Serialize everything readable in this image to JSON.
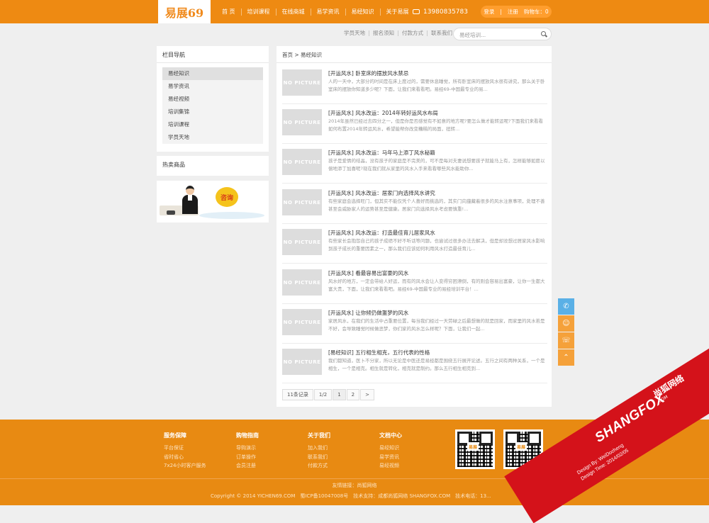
{
  "header": {
    "logo": "易展69",
    "nav": [
      "首 页",
      "培训课程",
      "在线商城",
      "易学资讯",
      "易经知识",
      "关于易展"
    ],
    "phone": "13980835783",
    "user_links": [
      "登录",
      "|",
      "注册",
      "购物车：0"
    ]
  },
  "sublinks": [
    "学员天地",
    "报名须知",
    "付款方式",
    "联系我们"
  ],
  "search": {
    "placeholder": "易经培训..."
  },
  "sidebar": {
    "title": "栏目导航",
    "items": [
      "易经知识",
      "易学资讯",
      "易经视频",
      "培训集锦",
      "培训课程",
      "学员天地"
    ],
    "hot_title": "热卖商品",
    "ad_text": "咨询"
  },
  "main": {
    "breadcrumb": "首页 > 易经知识",
    "placeholder_text": "NO PICTURE",
    "articles": [
      {
        "title": "[开运风水] 卧室床的摆放风水禁忌",
        "desc": "人的一天中，大部分的时间是在床上度过的，需要休息睡觉，所有卧室床的摆放风水很有讲究，那么关于卧室床的摆放你知道多少呢？下面，让我们来看看吧。易经69-中国最专业的易..."
      },
      {
        "title": "[开运风水] 风水改运：2014年转好运风水布局",
        "desc": "2014年虽然已经过去四分之一，但是你是否感觉有不如意的地方呢?要怎么做才能转运呢?下面我们来看看如何布置2014年转运风水，希望能帮你改变糟糕的局面，扭转..."
      },
      {
        "title": "[开运风水] 风水改运：马年马上添丁风水秘籍",
        "desc": "孩子是爱情的结晶，没有孩子的家庭是不完美的，可不是每对夫妻说想要孩子就能马上有，怎样能够如愿以偿地添丁加喜呢?现在我们就从家里的风水入手来看看哪些风水能助你..."
      },
      {
        "title": "[开运风水] 风水改运：居家门向选择风水讲究",
        "desc": "有些家庭会选择旺门，但其实不能仅凭个人喜好而挑选的，其实门向蕴藏着很多的风水注意事项，处理不善甚至会威胁家人的运势甚至是健康。居家门向选择风水考虑要慎重!..."
      },
      {
        "title": "[开运风水] 风水改运：打造最佳育儿居家风水",
        "desc": "有些家长会抱怨自己的孩子成绩不好不听话等问题，也尝试过很多办法去解决，但是却没想过居家风水影响到孩子成长的重要因素之一，那么我们应该如何利用风水打造最佳育儿..."
      },
      {
        "title": "[开运风水] 看最容易出富豪的风水",
        "desc": "风水好的地方，一定会带给人好运，而有的风水会让人变得穷困潦倒，有的则会容易出富豪，让你一生都大富大贵，下面，让我们来看看吧。易经69-中国最专业的易经培训平台！..."
      },
      {
        "title": "[开运风水] 让你倾仍做噩梦的风水",
        "desc": "家居风水，在我们的生活中占重要位置，每当我们经过一天劳碌之后最想做的就是回家，而家里的风水若是不好，会导致睡觉时候做恶梦，你们家的风水怎么样呢？下面，让我们一起..."
      },
      {
        "title": "[易经知识] 五行相生相克，五行代表的性格",
        "desc": "我们都知道，医卜不分家，所以无论是中医还是易经都是围绕五行展开论述。五行之间有两种关系，一个是相生，一个是相克。相生就是转化，相克就是制约。那么五行相生相克到..."
      }
    ],
    "pager": [
      "11条记录",
      "1/2",
      "1",
      "2",
      ">"
    ]
  },
  "side_tools": [
    "qq-icon",
    "service-icon",
    "phone-icon",
    "top-icon"
  ],
  "footer": {
    "columns": [
      {
        "title": "服务保障",
        "links": [
          "平台保证",
          "省时省心",
          "7x24小时客户服务"
        ]
      },
      {
        "title": "购物指南",
        "links": [
          "导购演示",
          "订单操作",
          "会员注册"
        ]
      },
      {
        "title": "关于我们",
        "links": [
          "加入我们",
          "联系我们",
          "付款方式"
        ]
      },
      {
        "title": "文档中心",
        "links": [
          "易经知识",
          "易学资讯",
          "易经视频"
        ]
      }
    ],
    "qr_label": "易展",
    "friend_links": "友情链接：尚狐网络",
    "copyright": "Copyright © 2014 YICHEN69.COM　蜀ICP备10047008号　技术支持：成都尚狐网络 SHANGFOX.COM　技术电话：13..."
  },
  "watermark": {
    "brand": "SHANGFOX",
    "brand_cn": "尚狐网络",
    "domain": ".COM",
    "design_by": "Design By: WeiDocheng",
    "design_time": "Design Time: 2014/02/05"
  },
  "colors": {
    "accent": "#ee8a12",
    "footer": "#e88a12",
    "side_blue": "#5ab0e6",
    "ribbon": "#d4121a"
  }
}
